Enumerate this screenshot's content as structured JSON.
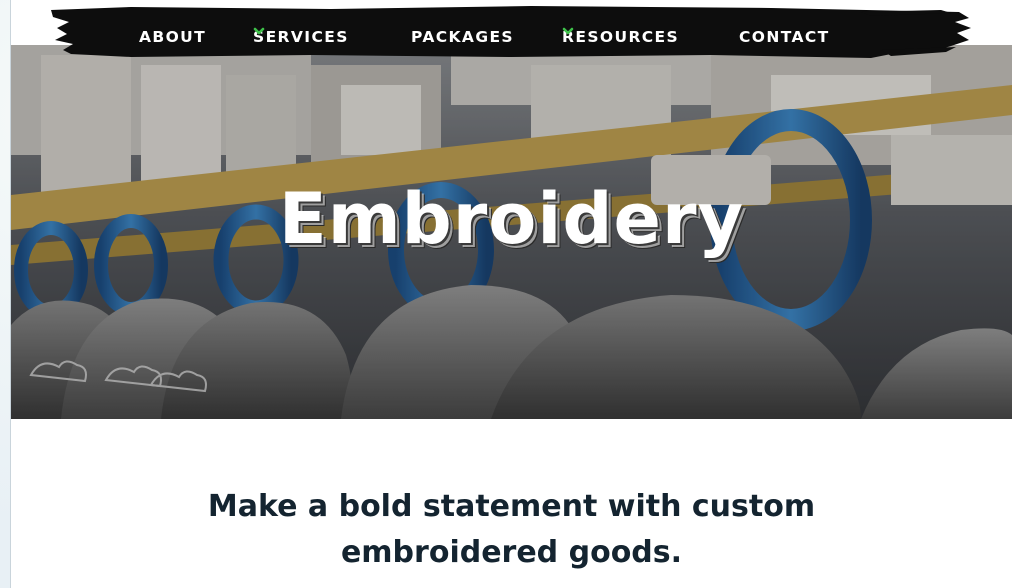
{
  "nav": {
    "items": [
      {
        "label": "ABOUT",
        "has_dropdown": false
      },
      {
        "label": "SERVICES",
        "has_dropdown": true
      },
      {
        "label": "PACKAGES",
        "has_dropdown": false
      },
      {
        "label": "RESOURCES",
        "has_dropdown": true
      },
      {
        "label": "CONTACT",
        "has_dropdown": false
      }
    ],
    "dropdown_icon": "chevron-down-icon",
    "accent_color": "#3ec24a",
    "bar_color": "#0d0d0d"
  },
  "hero": {
    "title": "Embroidery",
    "image": "embroidery-machines-and-caps-photo"
  },
  "intro": {
    "line1": "Make a bold statement with custom",
    "line2": "embroidered goods."
  }
}
